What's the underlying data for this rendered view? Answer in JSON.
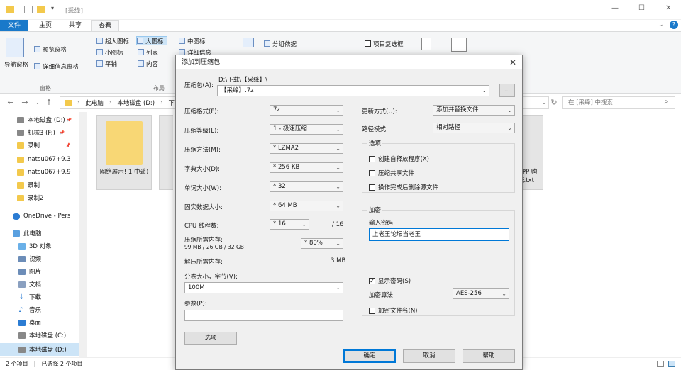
{
  "window": {
    "title": "[采绛]",
    "min_glyph": "—",
    "max_glyph": "☐",
    "close_glyph": "✕",
    "help_glyph": "?"
  },
  "ribbon": {
    "tabs": [
      "文件",
      "主页",
      "共享",
      "查看"
    ],
    "file_tab_color": "#1979ca",
    "nav_pane": "导航窗格",
    "preview_pane": "预览窗格",
    "details_pane": "详细信息窗格",
    "panes_group": "窗格",
    "layout_group": "布局",
    "layout_items": [
      "超大图标",
      "大图标",
      "中图标",
      "小图标",
      "列表",
      "详细信息",
      "平铺",
      "内容"
    ],
    "group_by": "分组依据",
    "item_checkbox": "项目复选框"
  },
  "address": {
    "path": [
      "此电脑",
      "本地磁盘 (D:)",
      "下"
    ],
    "search_placeholder": "在 [采绛] 中搜索"
  },
  "nav_pane": {
    "items": [
      {
        "label": "本地磁盘 (D:)",
        "pin": "📌"
      },
      {
        "label": "机械3 (F:)",
        "pin": "📌"
      },
      {
        "label": "录制",
        "pin": "📌"
      },
      {
        "label": "natsu067+9.3",
        "pin": ""
      },
      {
        "label": "natsu067+9.9",
        "pin": ""
      },
      {
        "label": "录制",
        "pin": ""
      },
      {
        "label": "录制2",
        "pin": ""
      },
      {
        "label": "OneDrive - Pers",
        "pin": ""
      },
      {
        "label": "此电脑",
        "pin": ""
      },
      {
        "label": "3D 对象",
        "pin": ""
      },
      {
        "label": "视频",
        "pin": ""
      },
      {
        "label": "图片",
        "pin": ""
      },
      {
        "label": "文档",
        "pin": ""
      },
      {
        "label": "下载",
        "pin": ""
      },
      {
        "label": "音乐",
        "pin": ""
      },
      {
        "label": "桌面",
        "pin": ""
      },
      {
        "label": "本地磁盘 (C:)",
        "pin": ""
      },
      {
        "label": "本地磁盘 (D:)",
        "pin": ""
      }
    ]
  },
  "files": [
    {
      "label": "网络展示! 1 中遥)"
    },
    {
      "label": "APP 购账.txt"
    }
  ],
  "status": {
    "count": "2 个项目",
    "selected": "已选择 2 个项目"
  },
  "dialog": {
    "title": "添加到压缩包",
    "archive_label": "压缩包(A):",
    "archive_dir": "D:\\下载\\【采绛】\\",
    "archive_name": "【采绛】.7z",
    "browse": "...",
    "format_label": "压缩格式(F):",
    "format_value": "7z",
    "level_label": "压缩等级(L):",
    "level_value": "1 - 极速压缩",
    "method_label": "压缩方法(M):",
    "method_value": "* LZMA2",
    "dict_label": "字典大小(D):",
    "dict_value": "* 256 KB",
    "word_label": "单词大小(W):",
    "word_value": "* 32",
    "solid_label": "固实数据大小:",
    "solid_value": "* 64 MB",
    "cpu_label": "CPU 线程数:",
    "cpu_value": "* 16",
    "cpu_total": "/ 16",
    "mem_comp_label": "压缩所需内存:",
    "mem_comp_sub": "99 MB / 26 GB / 32 GB",
    "mem_comp_value": "* 80%",
    "mem_decomp_label": "解压所需内存:",
    "mem_decomp_value": "3 MB",
    "split_label": "分卷大小，字节(V):",
    "split_value": "100M",
    "params_label": "参数(P):",
    "params_value": "",
    "options_btn": "选项",
    "update_label": "更新方式(U):",
    "update_value": "添加并替换文件",
    "path_label": "路径模式:",
    "path_value": "相对路径",
    "options_group": "选项",
    "opt_sfx": "创建自释放程序(X)",
    "opt_shared": "压缩共享文件",
    "opt_delete": "操作完成后删除源文件",
    "encrypt_group": "加密",
    "password_label": "输入密码:",
    "password_value": "上老王论坛当老王",
    "show_password": "显示密码(S)",
    "enc_method_label": "加密算法:",
    "enc_method_value": "AES-256",
    "encrypt_names": "加密文件名(N)",
    "ok": "确定",
    "cancel": "取消",
    "help": "帮助",
    "close_glyph": "✕"
  }
}
